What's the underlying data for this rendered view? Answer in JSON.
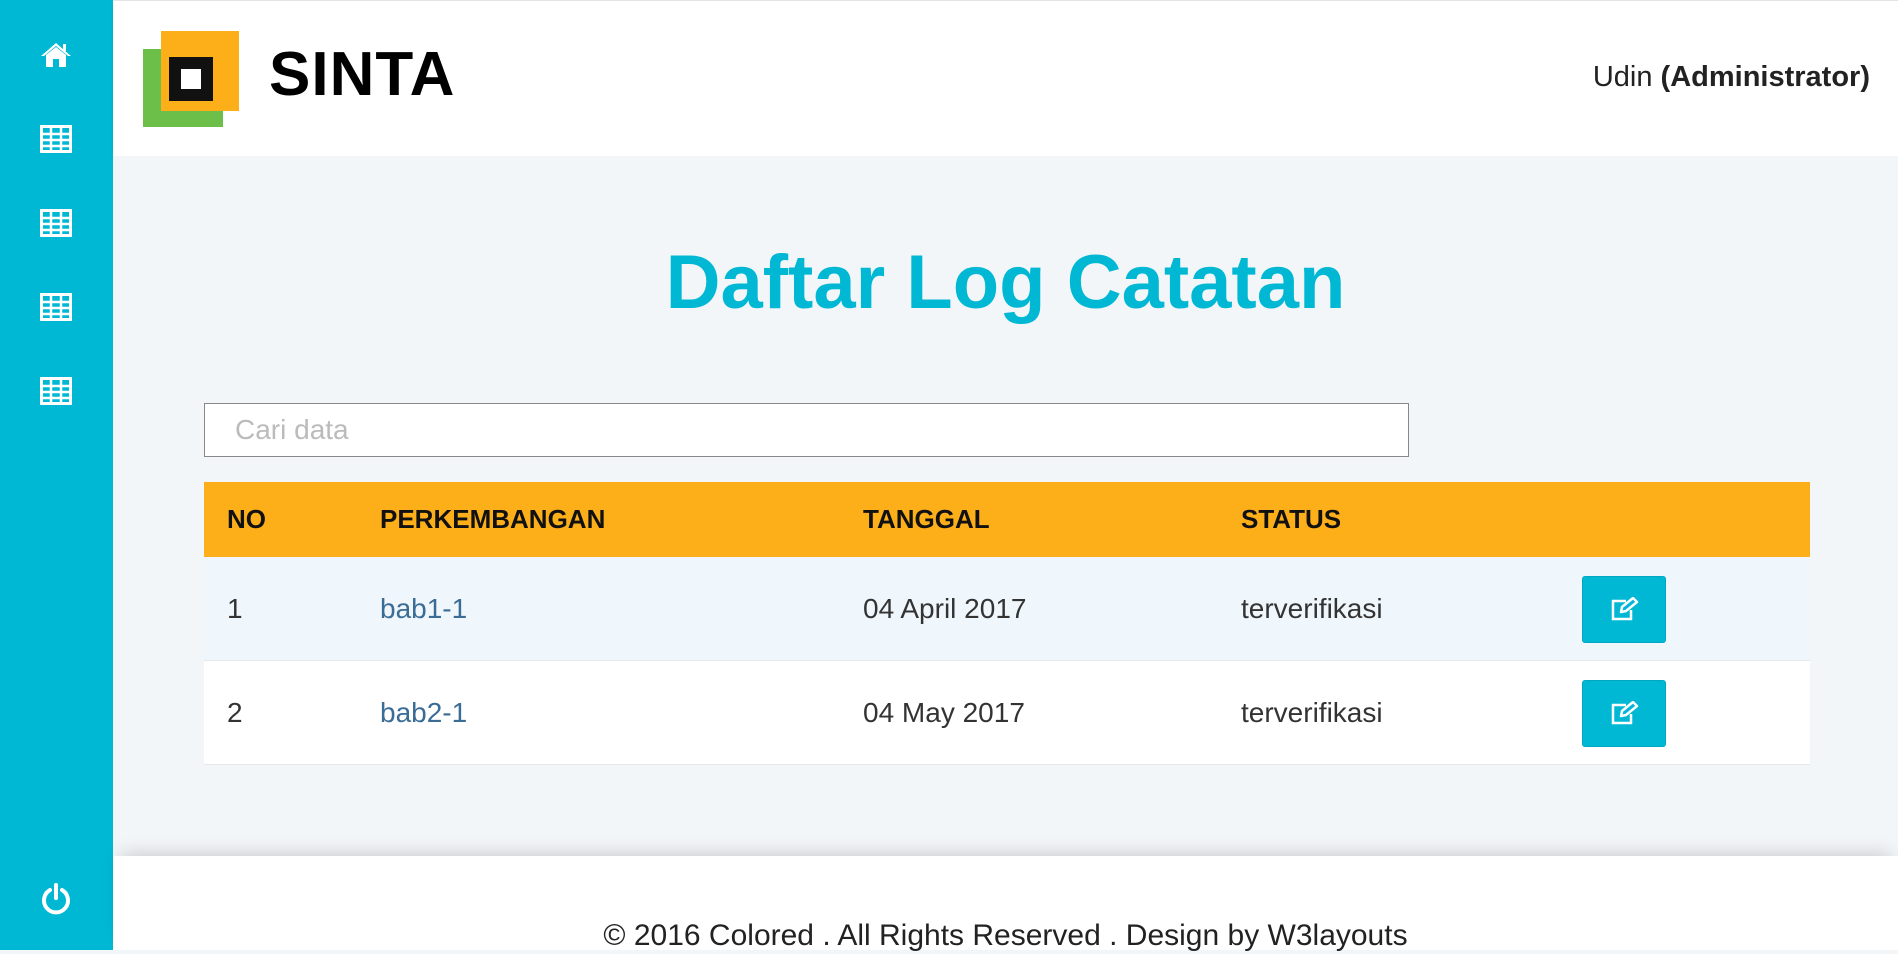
{
  "sidebar": {
    "items": [
      {
        "icon": "home-icon"
      },
      {
        "icon": "table-icon"
      },
      {
        "icon": "table-icon"
      },
      {
        "icon": "table-icon"
      },
      {
        "icon": "table-icon"
      }
    ],
    "logout_icon": "power-icon"
  },
  "header": {
    "brand": "SINTA",
    "user_name": "Udin",
    "user_role": "(Administrator)"
  },
  "main": {
    "title": "Daftar Log Catatan",
    "search_placeholder": "Cari data",
    "table": {
      "columns": [
        "NO",
        "PERKEMBANGAN",
        "TANGGAL",
        "STATUS"
      ],
      "rows": [
        {
          "no": "1",
          "perkembangan": "bab1-1",
          "tanggal": "04 April 2017",
          "status": "terverifikasi"
        },
        {
          "no": "2",
          "perkembangan": "bab2-1",
          "tanggal": "04 May 2017",
          "status": "terverifikasi"
        }
      ]
    }
  },
  "footer": {
    "text": "© 2016 Colored . All Rights Reserved . Design by W3layouts"
  },
  "colors": {
    "accent": "#00b8d4",
    "table_header": "#fdaf1a",
    "link": "#3a6c96"
  }
}
